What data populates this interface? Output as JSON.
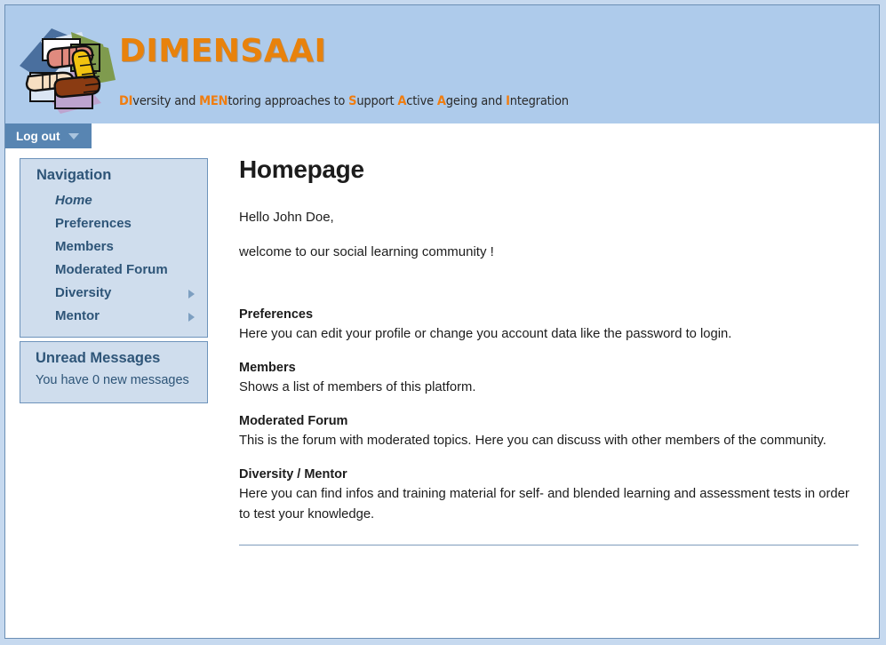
{
  "header": {
    "brand_title": "DIMENSAAI",
    "logo_alt": "four-hands-logo",
    "tagline_parts": [
      {
        "text": "DI",
        "highlight": true
      },
      {
        "text": "versity",
        "highlight": false
      },
      {
        "text": "  and ",
        "highlight": false
      },
      {
        "text": "MEN",
        "highlight": true
      },
      {
        "text": "toring",
        "highlight": false
      },
      {
        "text": "  approaches to ",
        "highlight": false
      },
      {
        "text": "S",
        "highlight": true
      },
      {
        "text": "upport ",
        "highlight": false
      },
      {
        "text": "A",
        "highlight": true
      },
      {
        "text": "ctive ",
        "highlight": false
      },
      {
        "text": "A",
        "highlight": true
      },
      {
        "text": "geing and ",
        "highlight": false
      },
      {
        "text": "I",
        "highlight": true
      },
      {
        "text": "ntegration",
        "highlight": false
      }
    ],
    "tagline_plain": "DIversity and MENtoring approaches to Support Active Ageing and Integration"
  },
  "tabbar": {
    "logout_label": "Log out",
    "caret_icon": "chevron-down-icon"
  },
  "sidebar": {
    "navigation": {
      "title": "Navigation",
      "items": [
        {
          "label": "Home",
          "active": true,
          "has_submenu": false
        },
        {
          "label": "Preferences",
          "active": false,
          "has_submenu": false
        },
        {
          "label": "Members",
          "active": false,
          "has_submenu": false
        },
        {
          "label": "Moderated Forum",
          "active": false,
          "has_submenu": false
        },
        {
          "label": "Diversity",
          "active": false,
          "has_submenu": true
        },
        {
          "label": "Mentor",
          "active": false,
          "has_submenu": true
        }
      ]
    },
    "messages": {
      "title": "Unread Messages",
      "text": "You have 0 new messages",
      "count": 0
    }
  },
  "main": {
    "page_title": "Homepage",
    "greeting": "Hello John Doe,",
    "welcome": "welcome to our social learning community !",
    "user_name": "John Doe",
    "sections": [
      {
        "heading": "Preferences",
        "body": "Here you can edit your profile or change you account data like the password to login."
      },
      {
        "heading": "Members",
        "body": "Shows a list of members of this platform."
      },
      {
        "heading": "Moderated Forum",
        "body": "This is the forum with moderated topics. Here you can discuss with other members of the community."
      },
      {
        "heading": "Diversity / Mentor",
        "body": "Here you can find infos and training material for self- and blended learning and assessment tests in order to test your knowledge."
      }
    ]
  },
  "colors": {
    "header_bg": "#aecbeb",
    "brand_orange": "#e8820c",
    "panel_bg": "#cfdded",
    "panel_border": "#6d93bb",
    "nav_text": "#2e5578",
    "tab_bg": "#5885b2",
    "page_border": "#6b8fb5",
    "rule": "#7e9cbc",
    "outer_bg": "#c6d9ef"
  }
}
